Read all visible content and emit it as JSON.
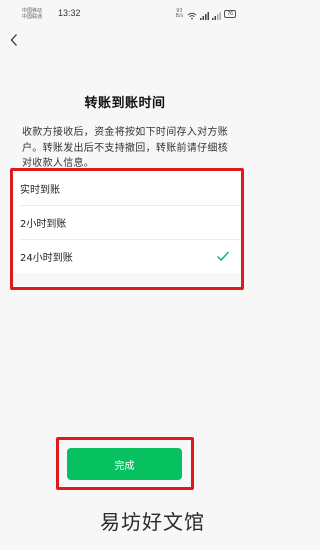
{
  "status_bar": {
    "carrier_1": "中国移动",
    "carrier_2": "中国联通",
    "time": "13:32",
    "speed_value": "93",
    "speed_unit": "B/s",
    "network_type": "4G",
    "battery": "76"
  },
  "page": {
    "title": "转账到账时间",
    "description": "收款方接收后，资金将按如下时间存入对方账户。转账发出后不支持撤回，转账前请仔细核对收款人信息。"
  },
  "options": [
    {
      "label": "实时到账",
      "selected": false
    },
    {
      "label": "2小时到账",
      "selected": false
    },
    {
      "label": "24小时到账",
      "selected": true
    }
  ],
  "done_button": {
    "label": "完成"
  },
  "colors": {
    "accent": "#07c160",
    "highlight": "#e0191c"
  },
  "watermark": "易坊好文馆"
}
